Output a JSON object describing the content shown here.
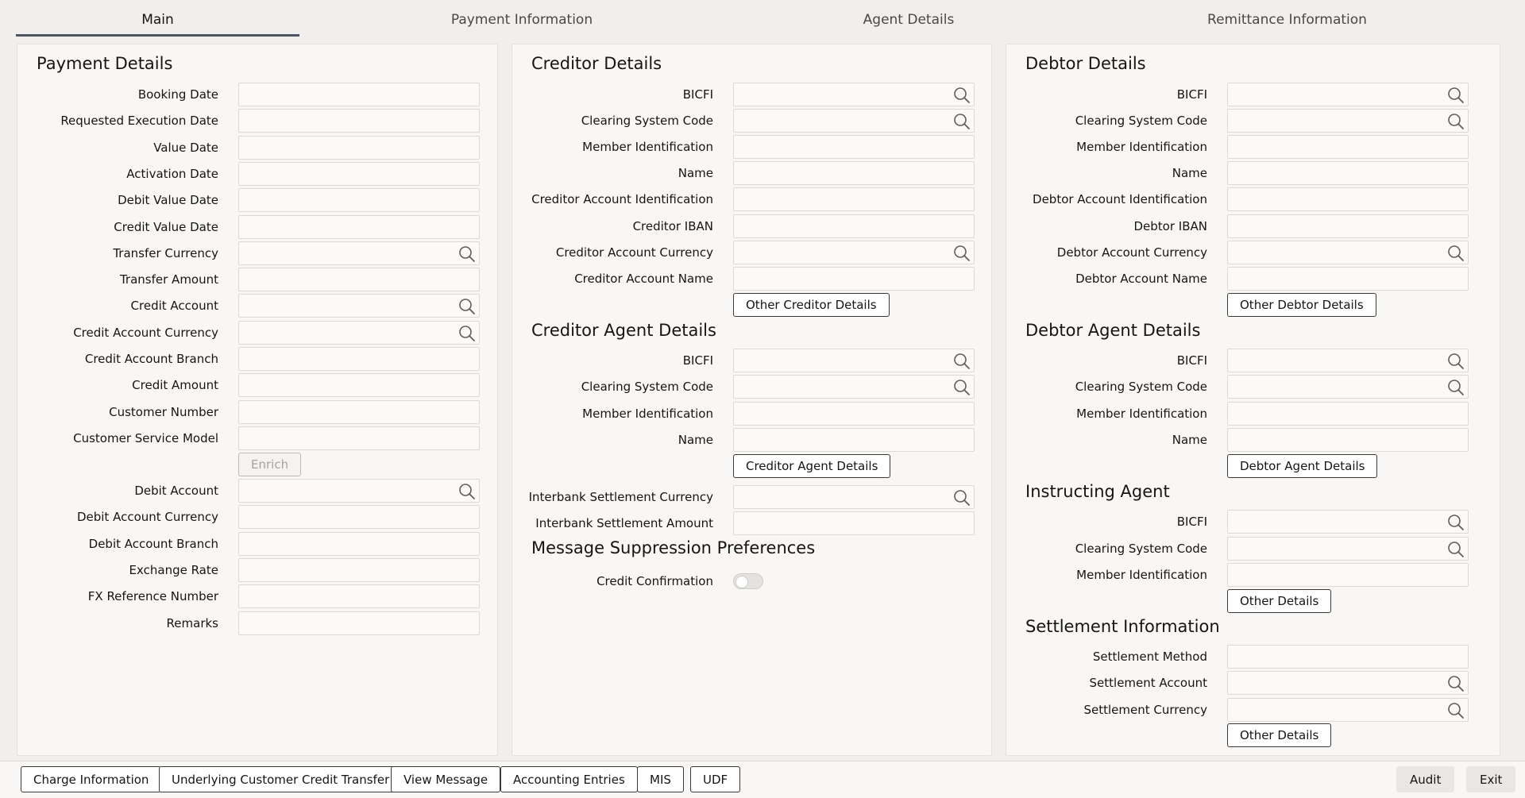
{
  "tabs": [
    {
      "label": "Main"
    },
    {
      "label": "Payment Information"
    },
    {
      "label": "Agent Details"
    },
    {
      "label": "Remittance Information"
    }
  ],
  "payment_details": {
    "title": "Payment Details",
    "fields": [
      {
        "label": "Booking Date",
        "search": false
      },
      {
        "label": "Requested Execution Date",
        "search": false
      },
      {
        "label": "Value Date",
        "search": false
      },
      {
        "label": "Activation Date",
        "search": false
      },
      {
        "label": "Debit Value Date",
        "search": false
      },
      {
        "label": "Credit Value Date",
        "search": false
      },
      {
        "label": "Transfer Currency",
        "search": true
      },
      {
        "label": "Transfer Amount",
        "search": false
      },
      {
        "label": "Credit Account",
        "search": true
      },
      {
        "label": "Credit Account Currency",
        "search": true
      },
      {
        "label": "Credit Account Branch",
        "search": false
      },
      {
        "label": "Credit Amount",
        "search": false
      },
      {
        "label": "Customer Number",
        "search": false
      },
      {
        "label": "Customer Service Model",
        "search": false
      }
    ],
    "enrich_label": "Enrich",
    "fields2": [
      {
        "label": "Debit Account",
        "search": true
      },
      {
        "label": "Debit Account Currency",
        "search": false
      },
      {
        "label": "Debit Account Branch",
        "search": false
      },
      {
        "label": "Exchange Rate",
        "search": false
      },
      {
        "label": "FX Reference Number",
        "search": false
      },
      {
        "label": "Remarks",
        "search": false
      }
    ]
  },
  "creditor_details": {
    "title": "Creditor Details",
    "fields": [
      {
        "label": "BICFI",
        "search": true
      },
      {
        "label": "Clearing System Code",
        "search": true
      },
      {
        "label": "Member Identification",
        "search": false
      },
      {
        "label": "Name",
        "search": false
      },
      {
        "label": "Creditor Account Identification",
        "search": false
      },
      {
        "label": "Creditor IBAN",
        "search": false
      },
      {
        "label": "Creditor Account Currency",
        "search": true
      },
      {
        "label": "Creditor Account Name",
        "search": false
      }
    ],
    "button": "Other Creditor Details"
  },
  "creditor_agent": {
    "title": "Creditor Agent Details",
    "fields": [
      {
        "label": "BICFI",
        "search": true
      },
      {
        "label": "Clearing System Code",
        "search": true
      },
      {
        "label": "Member Identification",
        "search": false
      },
      {
        "label": "Name",
        "search": false
      }
    ],
    "button": "Creditor Agent Details",
    "fields2": [
      {
        "label": "Interbank Settlement Currency",
        "search": true
      },
      {
        "label": "Interbank Settlement Amount",
        "search": false
      }
    ]
  },
  "message_suppression": {
    "title": "Message Suppression Preferences",
    "toggle_label": "Credit Confirmation"
  },
  "debtor_details": {
    "title": "Debtor Details",
    "fields": [
      {
        "label": "BICFI",
        "search": true
      },
      {
        "label": "Clearing System Code",
        "search": true
      },
      {
        "label": "Member Identification",
        "search": false
      },
      {
        "label": "Name",
        "search": false
      },
      {
        "label": "Debtor Account Identification",
        "search": false
      },
      {
        "label": "Debtor IBAN",
        "search": false
      },
      {
        "label": "Debtor Account Currency",
        "search": true
      },
      {
        "label": "Debtor Account Name",
        "search": false
      }
    ],
    "button": "Other Debtor Details"
  },
  "debtor_agent": {
    "title": "Debtor Agent Details",
    "fields": [
      {
        "label": "BICFI",
        "search": true
      },
      {
        "label": "Clearing System Code",
        "search": true
      },
      {
        "label": "Member Identification",
        "search": false
      },
      {
        "label": "Name",
        "search": false
      }
    ],
    "button": "Debtor Agent Details"
  },
  "instructing_agent": {
    "title": "Instructing Agent",
    "fields": [
      {
        "label": "BICFI",
        "search": true
      },
      {
        "label": "Clearing System Code",
        "search": true
      },
      {
        "label": "Member Identification",
        "search": false
      }
    ],
    "button": "Other Details"
  },
  "settlement_information": {
    "title": "Settlement Information",
    "fields": [
      {
        "label": "Settlement Method",
        "search": false
      },
      {
        "label": "Settlement Account",
        "search": true
      },
      {
        "label": "Settlement Currency",
        "search": true
      }
    ],
    "button": "Other Details"
  },
  "footer": {
    "left_buttons": [
      "Charge Information",
      "Underlying Customer Credit Transfer",
      "View Message",
      "Accounting Entries",
      "MIS",
      "UDF"
    ],
    "audit": "Audit",
    "exit": "Exit"
  }
}
